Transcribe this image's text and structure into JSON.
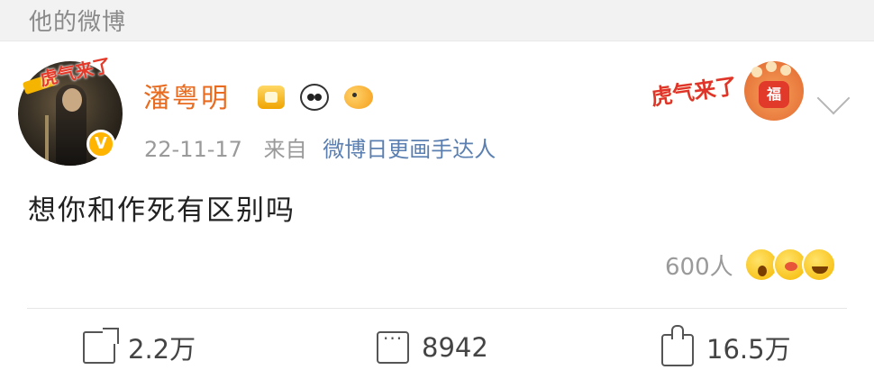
{
  "header": {
    "title": "他的微博"
  },
  "post": {
    "author": "潘粤明",
    "timestamp": "22-11-17",
    "from_prefix": "来自",
    "source": "微博日更画手达人",
    "content": "想你和作死有区别吗",
    "reaction_count": "600人",
    "avatar_frame_text": "虎气来了",
    "decor_text": "虎气来了",
    "decor_stamp": "福",
    "verified_badge": "V"
  },
  "actions": {
    "repost_count": "2.2万",
    "comment_count": "8942",
    "like_count": "16.5万"
  },
  "colors": {
    "username": "#e86b1f",
    "source_link": "#5a7fb0",
    "muted": "#9a9a9a",
    "header_bg": "#f2f2f2"
  }
}
